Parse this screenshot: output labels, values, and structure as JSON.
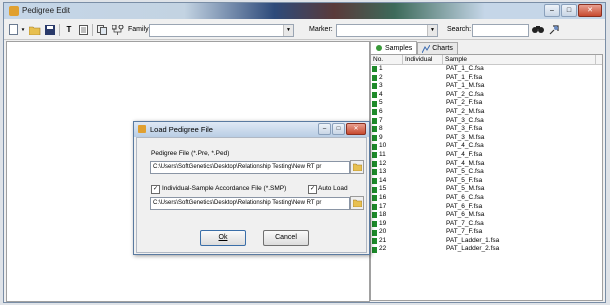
{
  "window": {
    "title": "Pedigree Edit",
    "caption_buttons": {
      "minimize": "–",
      "maximize": "□",
      "close": "✕"
    }
  },
  "toolbar": {
    "text_tool": "T",
    "family_label": "Family:",
    "family_value": "",
    "marker_label": "Marker:",
    "marker_value": "",
    "search_label": "Search:",
    "search_value": ""
  },
  "tabs": [
    {
      "label": "Samples",
      "active": true
    },
    {
      "label": "Charts",
      "active": false
    }
  ],
  "table": {
    "columns": [
      "No.",
      "Individual",
      "Sample"
    ],
    "rows": [
      {
        "no": "1",
        "individual": "",
        "sample": "PAT_1_C.fsa"
      },
      {
        "no": "2",
        "individual": "",
        "sample": "PAT_1_F.fsa"
      },
      {
        "no": "3",
        "individual": "",
        "sample": "PAT_1_M.fsa"
      },
      {
        "no": "4",
        "individual": "",
        "sample": "PAT_2_C.fsa"
      },
      {
        "no": "5",
        "individual": "",
        "sample": "PAT_2_F.fsa"
      },
      {
        "no": "6",
        "individual": "",
        "sample": "PAT_2_M.fsa"
      },
      {
        "no": "7",
        "individual": "",
        "sample": "PAT_3_C.fsa"
      },
      {
        "no": "8",
        "individual": "",
        "sample": "PAT_3_F.fsa"
      },
      {
        "no": "9",
        "individual": "",
        "sample": "PAT_3_M.fsa"
      },
      {
        "no": "10",
        "individual": "",
        "sample": "PAT_4_C.fsa"
      },
      {
        "no": "11",
        "individual": "",
        "sample": "PAT_4_F.fsa"
      },
      {
        "no": "12",
        "individual": "",
        "sample": "PAT_4_M.fsa"
      },
      {
        "no": "13",
        "individual": "",
        "sample": "PAT_5_C.fsa"
      },
      {
        "no": "14",
        "individual": "",
        "sample": "PAT_5_F.fsa"
      },
      {
        "no": "15",
        "individual": "",
        "sample": "PAT_5_M.fsa"
      },
      {
        "no": "16",
        "individual": "",
        "sample": "PAT_6_C.fsa"
      },
      {
        "no": "17",
        "individual": "",
        "sample": "PAT_6_F.fsa"
      },
      {
        "no": "18",
        "individual": "",
        "sample": "PAT_6_M.fsa"
      },
      {
        "no": "19",
        "individual": "",
        "sample": "PAT_7_C.fsa"
      },
      {
        "no": "20",
        "individual": "",
        "sample": "PAT_7_F.fsa"
      },
      {
        "no": "21",
        "individual": "",
        "sample": "PAT_Ladder_1.fsa"
      },
      {
        "no": "22",
        "individual": "",
        "sample": "PAT_Ladder_2.fsa"
      }
    ]
  },
  "dialog": {
    "title": "Load Pedigree File",
    "pedigree_label": "Pedigree File (*.Pre, *.Ped)",
    "pedigree_path": "C:\\Users\\SoftGenetics\\Desktop\\Relationship Testing\\New RT pr",
    "accordance_label": "Individual-Sample Accordance File (*.SMP)",
    "accordance_checked": true,
    "autoload_label": "Auto Load",
    "autoload_checked": true,
    "accordance_path": "C:\\Users\\SoftGenetics\\Desktop\\Relationship Testing\\New RT pr",
    "ok_label": "Ok",
    "cancel_label": "Cancel"
  },
  "colors": {
    "sample_marker": "#1e8a2a",
    "app_icon": "#e0a030"
  }
}
